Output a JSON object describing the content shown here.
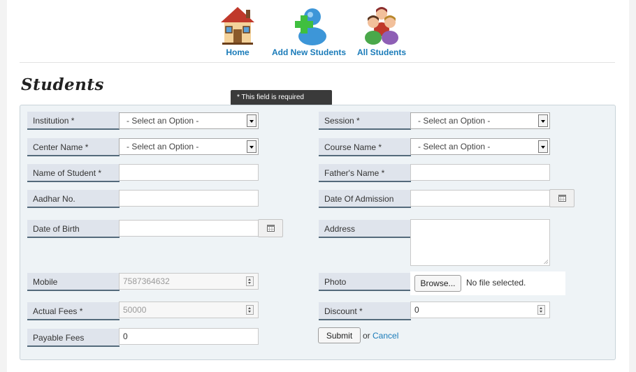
{
  "nav": {
    "home": "Home",
    "add_new": "Add New Students",
    "all_students": "All Students"
  },
  "page_title": "Students",
  "tooltip": "* This field is required",
  "form": {
    "institution": {
      "label": "Institution *",
      "value": "- Select an Option -"
    },
    "session": {
      "label": "Session *",
      "value": "- Select an Option -"
    },
    "center_name": {
      "label": "Center Name *",
      "value": "- Select an Option -"
    },
    "course_name": {
      "label": "Course Name *",
      "value": "- Select an Option -"
    },
    "student_name": {
      "label": "Name of Student *",
      "value": ""
    },
    "father_name": {
      "label": "Father's Name *",
      "value": ""
    },
    "aadhar": {
      "label": "Aadhar No.",
      "value": ""
    },
    "admission_date": {
      "label": "Date Of Admission",
      "value": ""
    },
    "dob": {
      "label": "Date of Birth",
      "value": ""
    },
    "address": {
      "label": "Address",
      "value": ""
    },
    "mobile": {
      "label": "Mobile",
      "value": "7587364632"
    },
    "photo": {
      "label": "Photo",
      "browse": "Browse...",
      "status": "No file selected."
    },
    "actual_fees": {
      "label": "Actual Fees *",
      "value": "50000"
    },
    "discount": {
      "label": "Discount *",
      "value": "0"
    },
    "payable_fees": {
      "label": "Payable Fees",
      "value": "0"
    },
    "submit": "Submit",
    "or": "or",
    "cancel": "Cancel"
  },
  "colors": {
    "link": "#1a7bb9",
    "label_bg": "#dfe4ec",
    "panel_bg": "#eef3f6",
    "tooltip_bg": "#3a3a3a"
  }
}
